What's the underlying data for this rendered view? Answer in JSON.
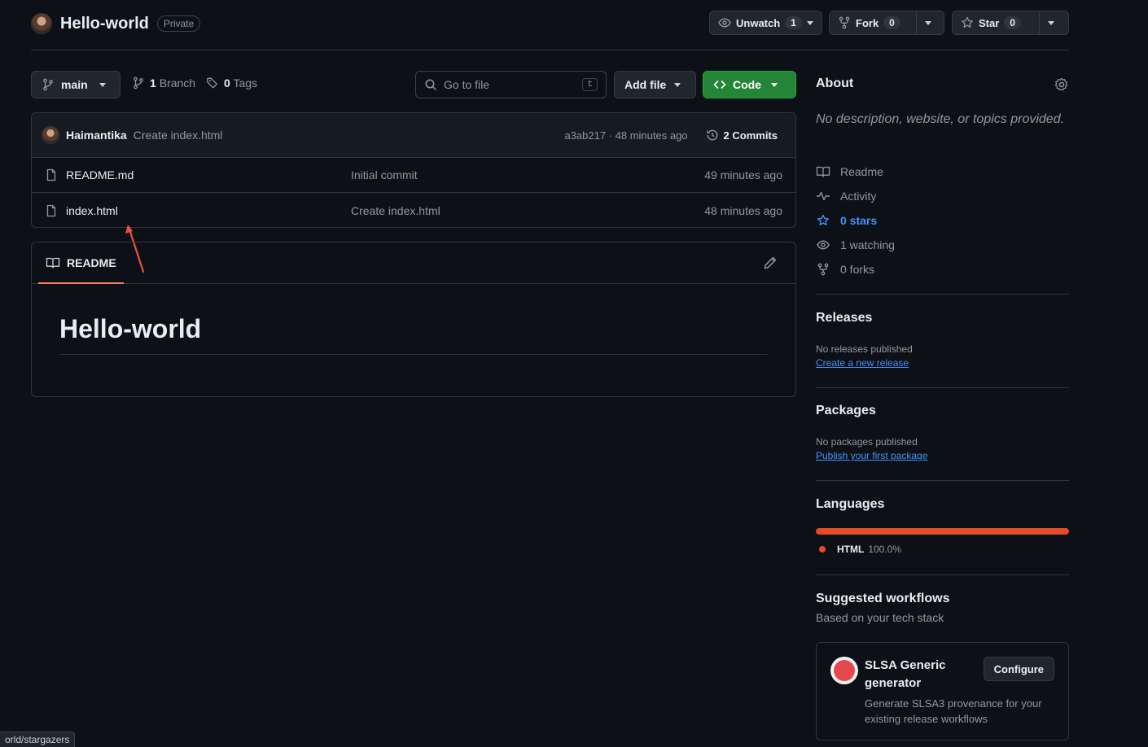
{
  "repo": {
    "name": "Hello-world",
    "visibility": "Private"
  },
  "header_actions": {
    "watch_label": "Unwatch",
    "watch_count": "1",
    "fork_label": "Fork",
    "fork_count": "0",
    "star_label": "Star",
    "star_count": "0"
  },
  "toolbar": {
    "branch": "main",
    "branches_count": "1",
    "branches_label": "Branch",
    "tags_count": "0",
    "tags_label": "Tags",
    "goto_placeholder": "Go to file",
    "goto_shortcut": "t",
    "add_file_label": "Add file",
    "code_label": "Code"
  },
  "latest_commit": {
    "author": "Haimantika",
    "message": "Create index.html",
    "sha_time": "a3ab217 · 48 minutes ago",
    "commits_label": "2 Commits"
  },
  "files": [
    {
      "name": "README.md",
      "message": "Initial commit",
      "time": "49 minutes ago"
    },
    {
      "name": "index.html",
      "message": "Create index.html",
      "time": "48 minutes ago"
    }
  ],
  "readme": {
    "tab_label": "README",
    "heading": "Hello-world"
  },
  "about": {
    "title": "About",
    "description": "No description, website, or topics provided.",
    "items": [
      {
        "label": "Readme",
        "icon": "book-icon"
      },
      {
        "label": "Activity",
        "icon": "pulse-icon"
      },
      {
        "label": "0 stars",
        "icon": "star-icon"
      },
      {
        "label": "1 watching",
        "icon": "eye-icon"
      },
      {
        "label": "0 forks",
        "icon": "fork-icon"
      }
    ]
  },
  "releases": {
    "title": "Releases",
    "status": "No releases published",
    "link": "Create a new release"
  },
  "packages": {
    "title": "Packages",
    "status": "No packages published",
    "link": "Publish your first package"
  },
  "languages": {
    "title": "Languages",
    "items": [
      {
        "name": "HTML",
        "percent": "100.0%",
        "share": 1.0,
        "color": "#e34c26"
      }
    ]
  },
  "suggested_workflows": {
    "title": "Suggested workflows",
    "subtitle": "Based on your tech stack",
    "card": {
      "title": "SLSA Generic generator",
      "description": "Generate SLSA3 provenance for your existing release workflows",
      "button": "Configure"
    }
  },
  "status_bar": {
    "url": "orld/stargazers"
  },
  "colors": {
    "accent_green": "#238636",
    "link_blue": "#4493f8",
    "annotation_red": "#e5533d"
  }
}
